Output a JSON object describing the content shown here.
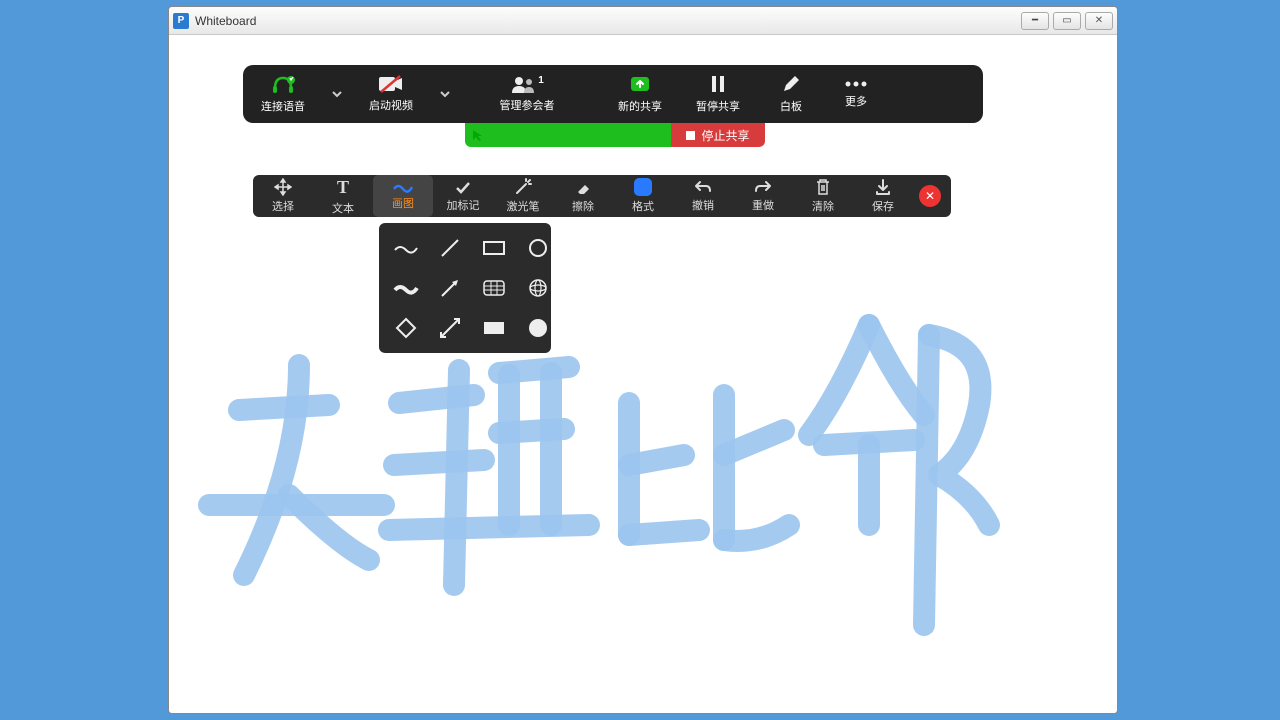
{
  "window": {
    "title": "Whiteboard"
  },
  "zoombar": {
    "audio": "连接语音",
    "video": "启动视频",
    "participants": "管理参会者",
    "participants_count": "1",
    "new_share": "新的共享",
    "pause": "暂停共享",
    "whiteboard": "白板",
    "more": "更多"
  },
  "share_strip": {
    "stop": "停止共享"
  },
  "annotate": {
    "select": "选择",
    "text": "文本",
    "draw": "画图",
    "stamp": "加标记",
    "spotlight": "激光笔",
    "eraser": "擦除",
    "format": "格式",
    "undo": "撤销",
    "redo": "重做",
    "clear": "清除",
    "save": "保存"
  },
  "shape_popup": {
    "items": [
      "wavy-line",
      "line",
      "rect-outline",
      "circle-outline",
      "wavy-thick",
      "arrow-line",
      "grid",
      "globe",
      "diamond",
      "double-arrow",
      "rect-filled",
      "circle-filled"
    ]
  },
  "handwriting_hint": "天涯比邻"
}
